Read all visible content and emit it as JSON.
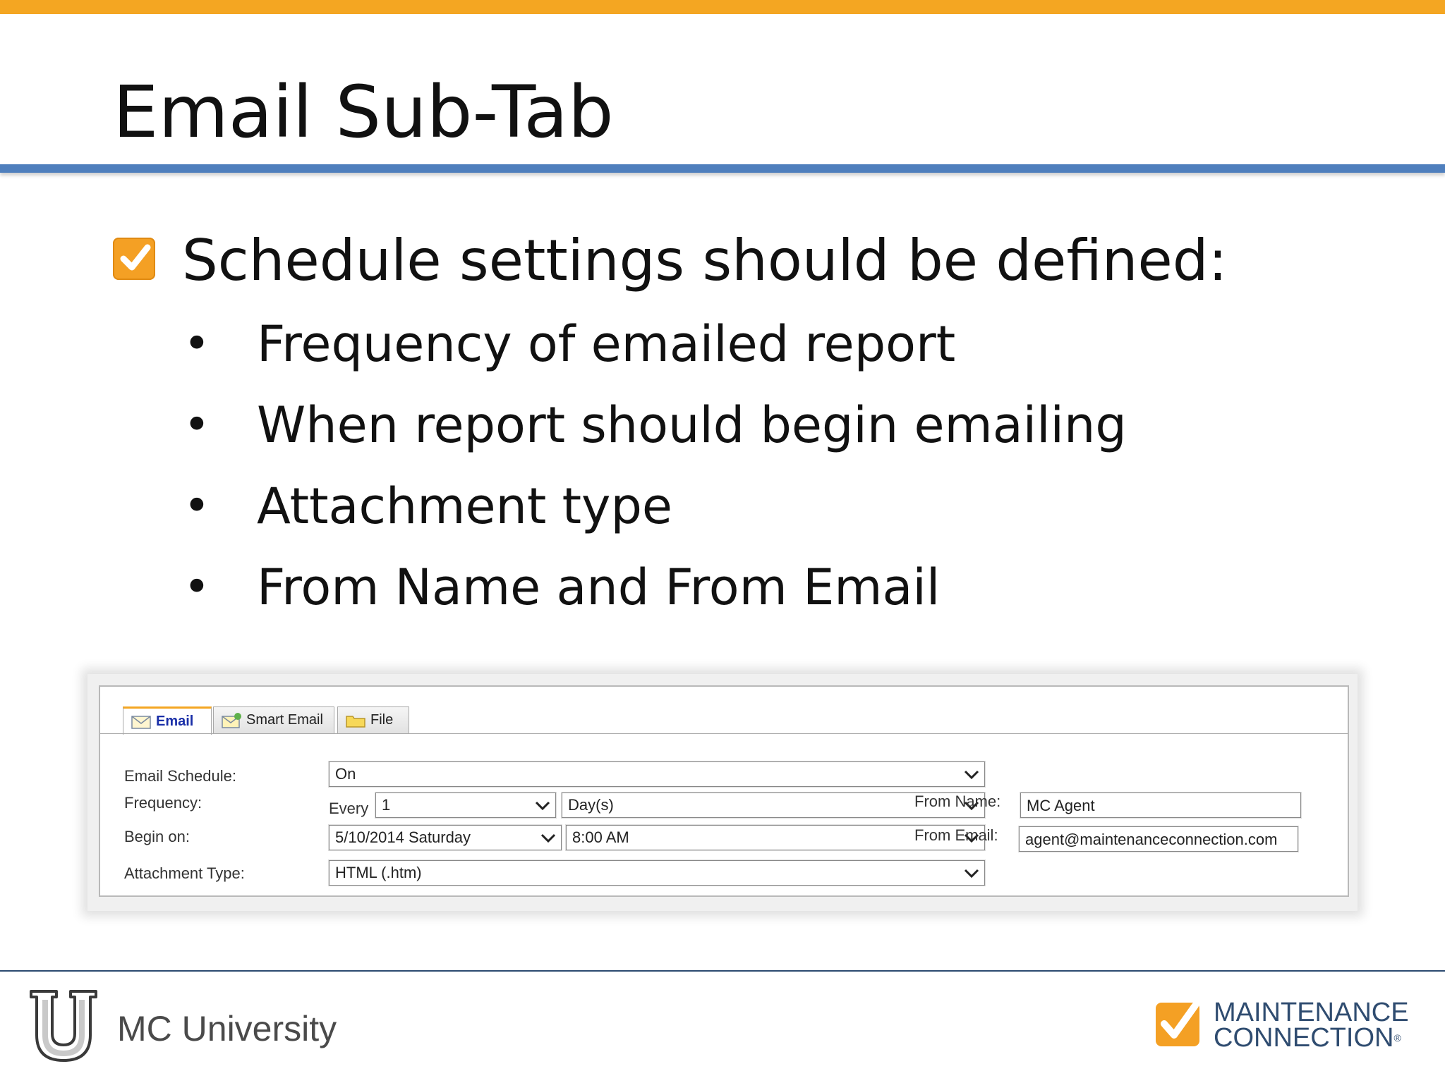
{
  "slide": {
    "title": "Email Sub-Tab",
    "main_point": "Schedule settings should be defined:",
    "bullets": [
      "Frequency of emailed report",
      "When report should begin emailing",
      "Attachment type",
      "From Name and From Email"
    ]
  },
  "panel": {
    "tabs": [
      {
        "label": "Email",
        "icon": "envelope-icon"
      },
      {
        "label": "Smart Email",
        "icon": "smart-email-icon"
      },
      {
        "label": "File",
        "icon": "folder-icon"
      }
    ],
    "labels": {
      "email_schedule": "Email Schedule:",
      "frequency": "Frequency:",
      "begin_on": "Begin on:",
      "attachment_type": "Attachment Type:",
      "every": "Every",
      "from_name": "From Name:",
      "from_email": "From Email:"
    },
    "values": {
      "email_schedule": "On",
      "frequency_count": "1",
      "frequency_unit": "Day(s)",
      "begin_date": "5/10/2014 Saturday",
      "begin_time": "8:00 AM",
      "attachment_type": "HTML (.htm)",
      "from_name": "MC Agent",
      "from_email": "agent@maintenanceconnection.com"
    }
  },
  "footer": {
    "university": "MC University",
    "brand_line1": "MAINTENANCE",
    "brand_line2": "CONNECTION",
    "trademark": "®"
  },
  "colors": {
    "accent_orange": "#f4a622",
    "title_rule_blue": "#4f7fbd",
    "footer_navy": "#2f4c70",
    "active_tab_text": "#1a2fa8"
  }
}
